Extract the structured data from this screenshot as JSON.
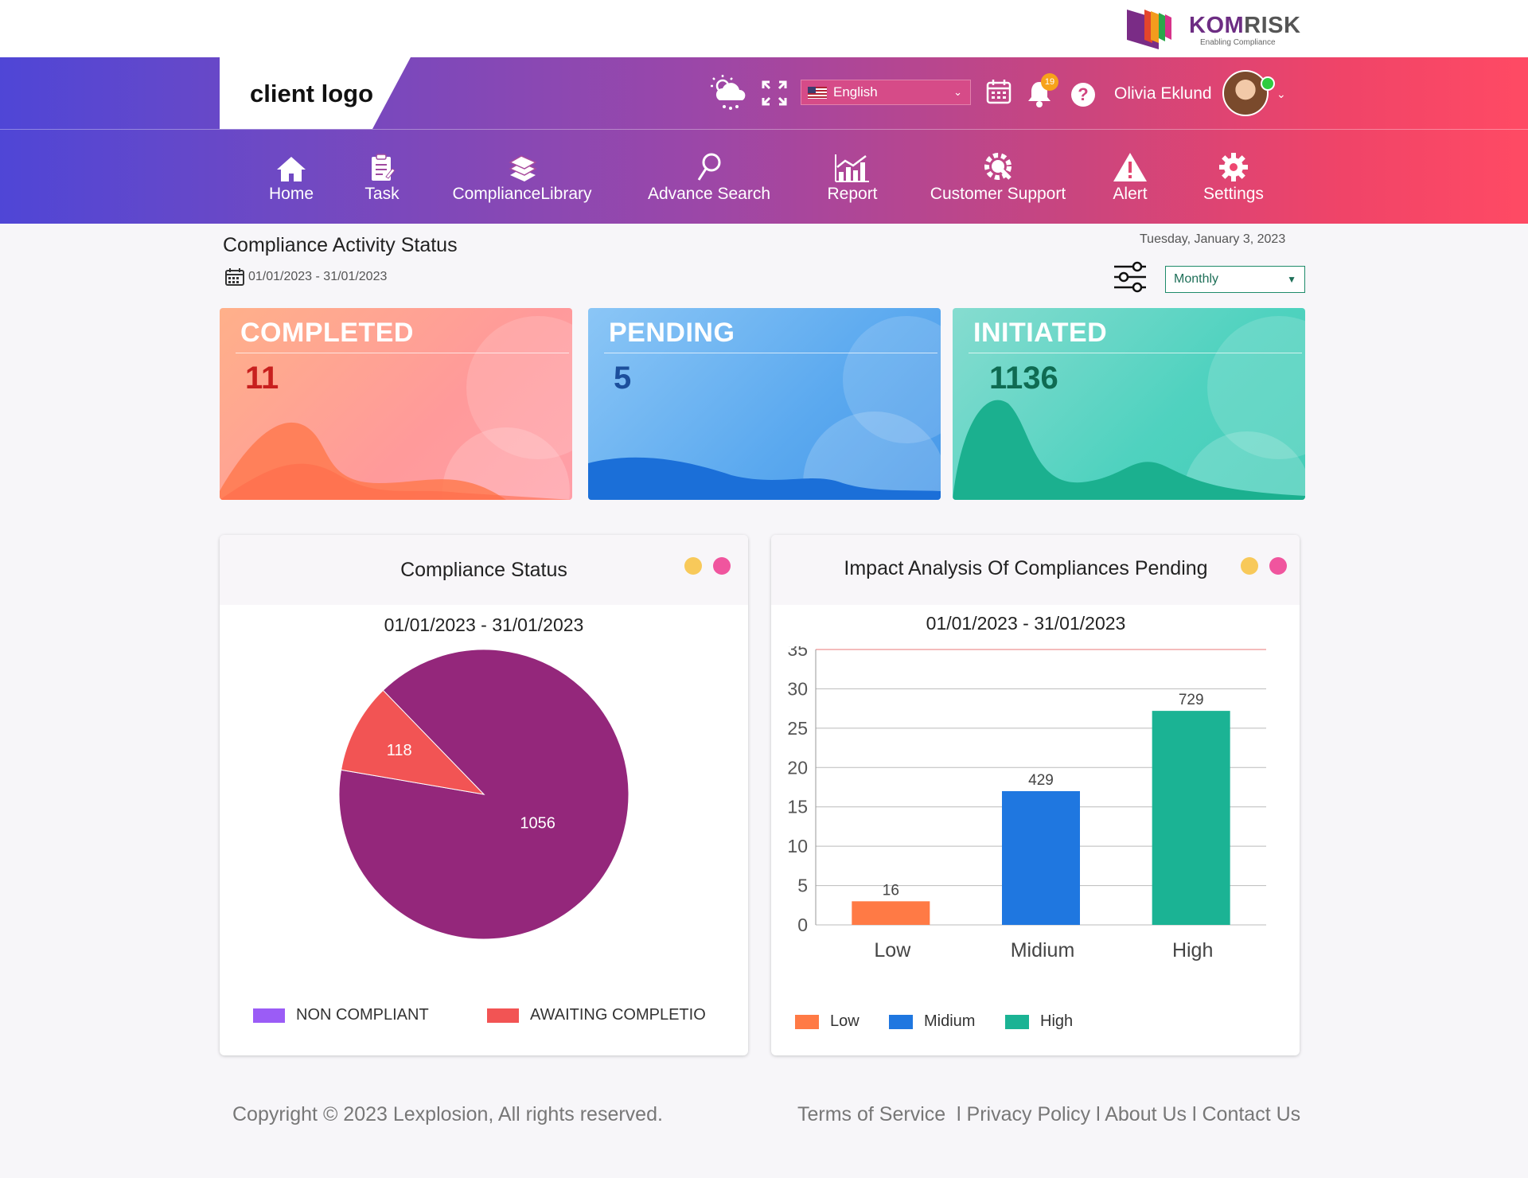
{
  "brand": {
    "name_part1": "KOM",
    "name_part2": "RISK",
    "tagline": "Enabling Compliance",
    "client_logo": "client logo"
  },
  "header": {
    "language": "English",
    "notification_count": "19",
    "help_label": "?",
    "user_name": "Olivia Eklund",
    "icons": [
      "weather-icon",
      "fullscreen-icon",
      "calendar-icon",
      "bell-icon",
      "help-icon"
    ]
  },
  "nav": [
    {
      "label": "Home",
      "icon": "home-icon"
    },
    {
      "label": "Task",
      "icon": "task-icon"
    },
    {
      "label": "ComplianceLibrary",
      "icon": "books-icon"
    },
    {
      "label": "Advance Search",
      "icon": "search-icon"
    },
    {
      "label": "Report",
      "icon": "report-icon"
    },
    {
      "label": "Customer Support",
      "icon": "support-icon"
    },
    {
      "label": "Alert",
      "icon": "alert-icon"
    },
    {
      "label": "Settings",
      "icon": "gear-icon"
    }
  ],
  "activity": {
    "title": "Compliance Activity Status",
    "date_range": "01/01/2023 - 31/01/2023",
    "today": "Tuesday, January 3, 2023",
    "period": "Monthly"
  },
  "cards": [
    {
      "title": "COMPLETED",
      "value": "11",
      "value_color": "#c8201e"
    },
    {
      "title": "PENDING",
      "value": "5",
      "value_color": "#1c4f9c"
    },
    {
      "title": "INITIATED",
      "value": "1136",
      "value_color": "#0f6b52"
    }
  ],
  "compliance_status": {
    "title": "Compliance Status",
    "date_range": "01/01/2023 - 31/01/2023",
    "legend": [
      {
        "label": "NON COMPLIANT",
        "color": "#9b5cf6"
      },
      {
        "label": "AWAITING COMPLETIO",
        "color": "#f25454"
      }
    ]
  },
  "impact": {
    "title": "Impact Analysis Of Compliances Pending",
    "date_range": "01/01/2023 - 31/01/2023",
    "legend": [
      {
        "label": "Low",
        "color": "#ff7a45"
      },
      {
        "label": "Midium",
        "color": "#1f77e0"
      },
      {
        "label": "High",
        "color": "#1bb394"
      }
    ]
  },
  "chart_data": [
    {
      "type": "pie",
      "title": "Compliance Status",
      "slices": [
        {
          "label": "NON COMPLIANT",
          "value": 1056,
          "color": "#94277b"
        },
        {
          "label": "AWAITING COMPLETIO",
          "value": 118,
          "color": "#f25454"
        }
      ]
    },
    {
      "type": "bar",
      "title": "Impact Analysis Of Compliances Pending",
      "categories": [
        "Low",
        "Midium",
        "High"
      ],
      "bar_heights": [
        3,
        17,
        27.2
      ],
      "data_labels": [
        "16",
        "429",
        "729"
      ],
      "colors": [
        "#ff7a45",
        "#1f77e0",
        "#1bb394"
      ],
      "ylim": [
        0,
        35
      ],
      "yticks": [
        0,
        5,
        10,
        15,
        20,
        25,
        30,
        35
      ],
      "grid": true
    }
  ],
  "footer": {
    "copyright": "Copyright © 2023 Lexplosion, All rights reserved.",
    "links": "Terms of Service  l Privacy Policy l About Us l Contact Us"
  }
}
